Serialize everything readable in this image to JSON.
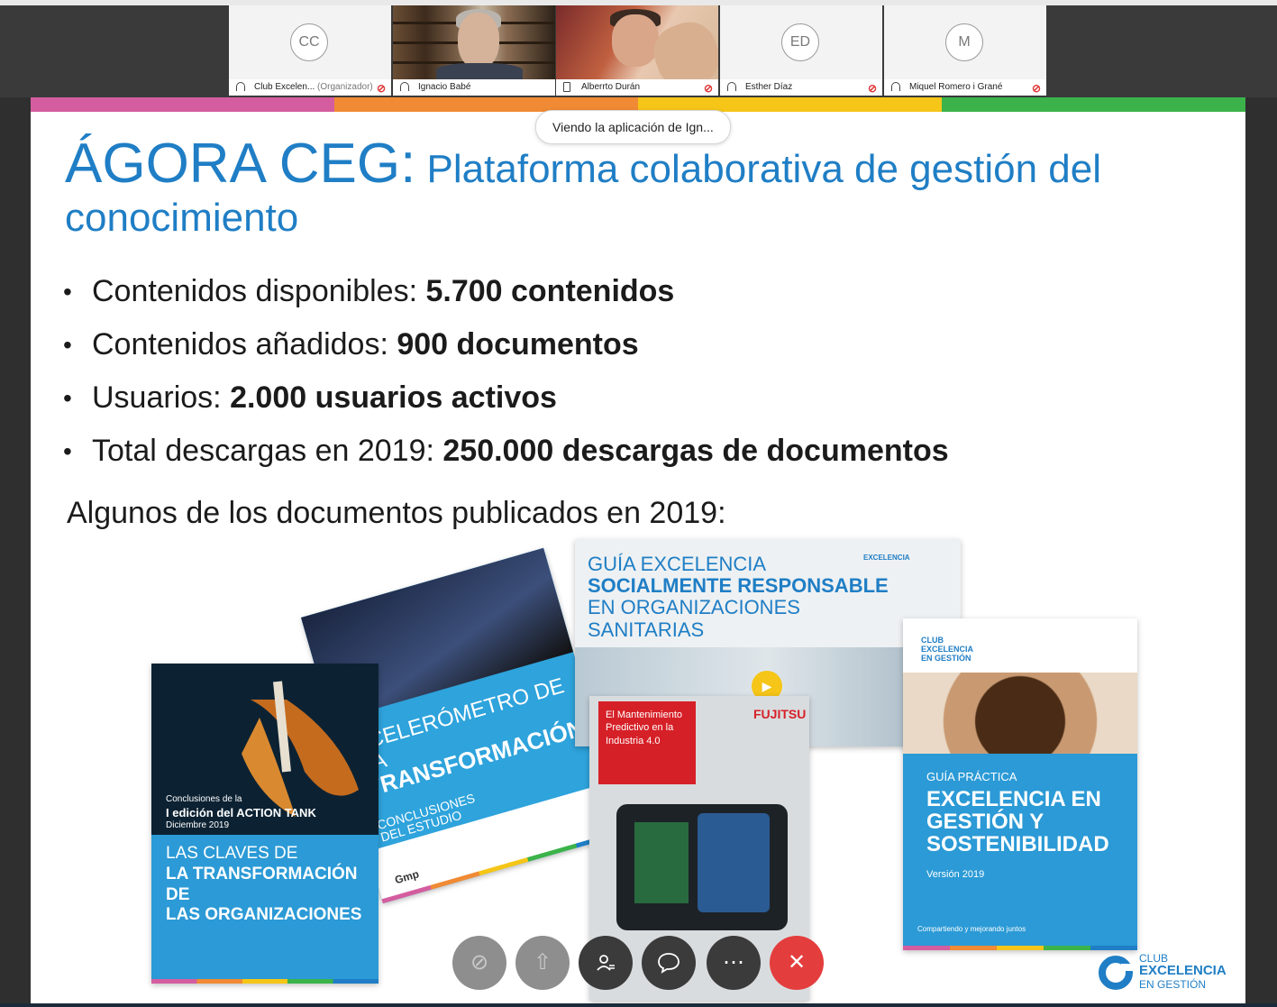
{
  "participants": [
    {
      "initials": "CC",
      "name": "Club Excelen...",
      "role": "(Organizador)"
    },
    {
      "name": "Ignacio Babé"
    },
    {
      "name": "Alberrto Durán"
    },
    {
      "initials": "ED",
      "name": "Esther Díaz"
    },
    {
      "initials": "M",
      "name": "Miquel Romero i Grané"
    }
  ],
  "viewing_banner": "Viendo la aplicación de Ign...",
  "slide": {
    "title_big": "ÁGORA CEG:",
    "title_rest": " Plataforma colaborativa de gestión del conocimiento",
    "bullets": [
      {
        "label": "Contenidos disponibles: ",
        "value": "5.700 contenidos"
      },
      {
        "label": "Contenidos añadidos: ",
        "value": "900 documentos"
      },
      {
        "label": "Usuarios: ",
        "value": "2.000 usuarios activos"
      },
      {
        "label": "Total descargas en 2019: ",
        "value": "250.000 descargas de documentos"
      }
    ],
    "subtitle": "Algunos de los documentos publicados en 2019:",
    "covers": {
      "claves": {
        "intro1": "Conclusiones de la",
        "intro2": "I edición del ACTION TANK",
        "intro3": "Diciembre 2019",
        "title1": "LAS CLAVES DE",
        "title2": "LA TRANSFORMACIÓN DE",
        "title3": "LAS ORGANIZACIONES"
      },
      "acelerometro": {
        "title1": "ACELERÓMETRO DE LA",
        "title2": "TRANSFORMACIÓN",
        "sub1": "CONCLUSIONES",
        "sub2": "DEL ESTUDIO",
        "brand": "Gmp"
      },
      "guia_rs": {
        "line1": "GUÍA EXCELENCIA",
        "line2": "SOCIALMENTE RESPONSABLE",
        "line3": "EN ORGANIZACIONES",
        "line4": "SANITARIAS"
      },
      "mantenimiento": {
        "title": "El Mantenimiento Predictivo en la Industria 4.0",
        "brand": "FUJITSU"
      },
      "sostenibilidad": {
        "kicker": "GUÍA PRÁCTICA",
        "title1": "EXCELENCIA EN",
        "title2": "GESTIÓN Y",
        "title3": "SOSTENIBILIDAD",
        "version": "Versión 2019",
        "footer": "Compartiendo y mejorando juntos"
      },
      "club_logo_line1": "CLUB",
      "club_logo_line2": "EXCELENCIA",
      "club_logo_line3": "EN GESTIÓN"
    }
  },
  "footer_logo": {
    "line1": "CLUB",
    "line2": "EXCELENCIA",
    "line3": "EN GESTIÓN"
  },
  "controls": [
    {
      "icon": "microphone-off-icon"
    },
    {
      "icon": "share-icon"
    },
    {
      "icon": "participants-icon"
    },
    {
      "icon": "chat-icon"
    },
    {
      "icon": "more-icon"
    },
    {
      "icon": "hang-up-icon"
    }
  ],
  "colors": {
    "title_blue": "#1f7ec5",
    "stripe_pink": "#d45d9f",
    "stripe_orange": "#f08a34",
    "stripe_yellow": "#f5c518",
    "stripe_green": "#3bb34a",
    "active_speaker": "#1aa8e0",
    "hangup_red": "#e43d3d"
  }
}
